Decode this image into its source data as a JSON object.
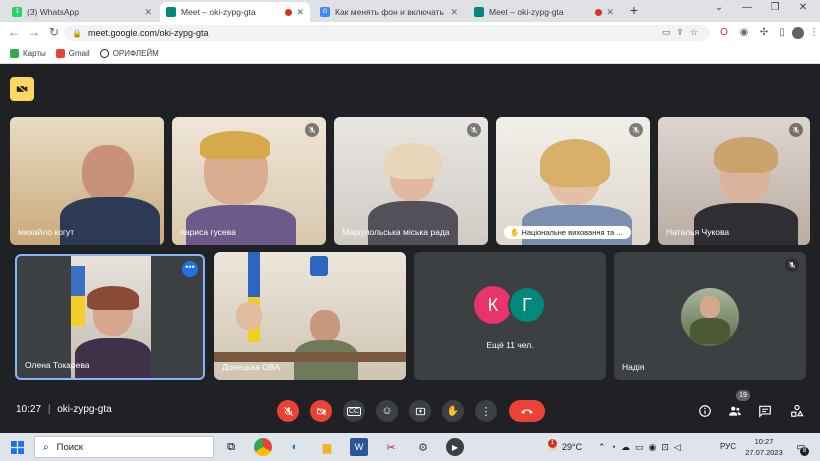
{
  "browser": {
    "tabs": [
      {
        "label": "(3) WhatsApp",
        "fav_color": "#25d366",
        "fav_text": "3"
      },
      {
        "label": "Meet – oki-zypg-gta",
        "fav_color": "#00897b",
        "fav_text": ""
      },
      {
        "label": "Как менять фон и включать вид",
        "fav_color": "#4285f4",
        "fav_text": "G"
      },
      {
        "label": "Meet – oki-zypg-gta",
        "fav_color": "#00897b",
        "fav_text": ""
      }
    ],
    "new_tab": "+",
    "url": "meet.google.com/oki-zypg-gta",
    "bookmarks": [
      {
        "label": "Карты",
        "color": "#34a853"
      },
      {
        "label": "Gmail",
        "color": "#ea4335"
      },
      {
        "label": "ОРИФЛЕЙМ",
        "color": "#202124"
      }
    ]
  },
  "participants": [
    {
      "name": "михайло когут",
      "muted": false
    },
    {
      "name": "лариса гусева",
      "muted": true
    },
    {
      "name": "Маріупольська міська рада",
      "muted": true
    },
    {
      "name": "Національне виховання та ...",
      "muted": true
    },
    {
      "name": "Наталья Чукова",
      "muted": true
    },
    {
      "name": "Олена Токарева",
      "muted": false
    },
    {
      "name": "Донецька ОВА",
      "muted": false
    },
    {
      "name": "Надія",
      "muted": true
    }
  ],
  "others": {
    "avatars": [
      {
        "letter": "К",
        "color": "#e8336b"
      },
      {
        "letter": "Г",
        "color": "#00897b"
      }
    ],
    "label": "Ещё 11 чел."
  },
  "meeting": {
    "time": "10:27",
    "code": "oki-zypg-gta",
    "people_count": "19"
  },
  "taskbar": {
    "search_placeholder": "Поиск",
    "weather": "29°C",
    "weather_badge": "1",
    "lang": "РУС",
    "clock_time": "10:27",
    "clock_date": "27.07.2023",
    "notif_count": "8"
  },
  "colors": {
    "accent_blue": "#8ab4f8",
    "hangup_red": "#ea4335",
    "camera_badge": "#fdd663"
  }
}
